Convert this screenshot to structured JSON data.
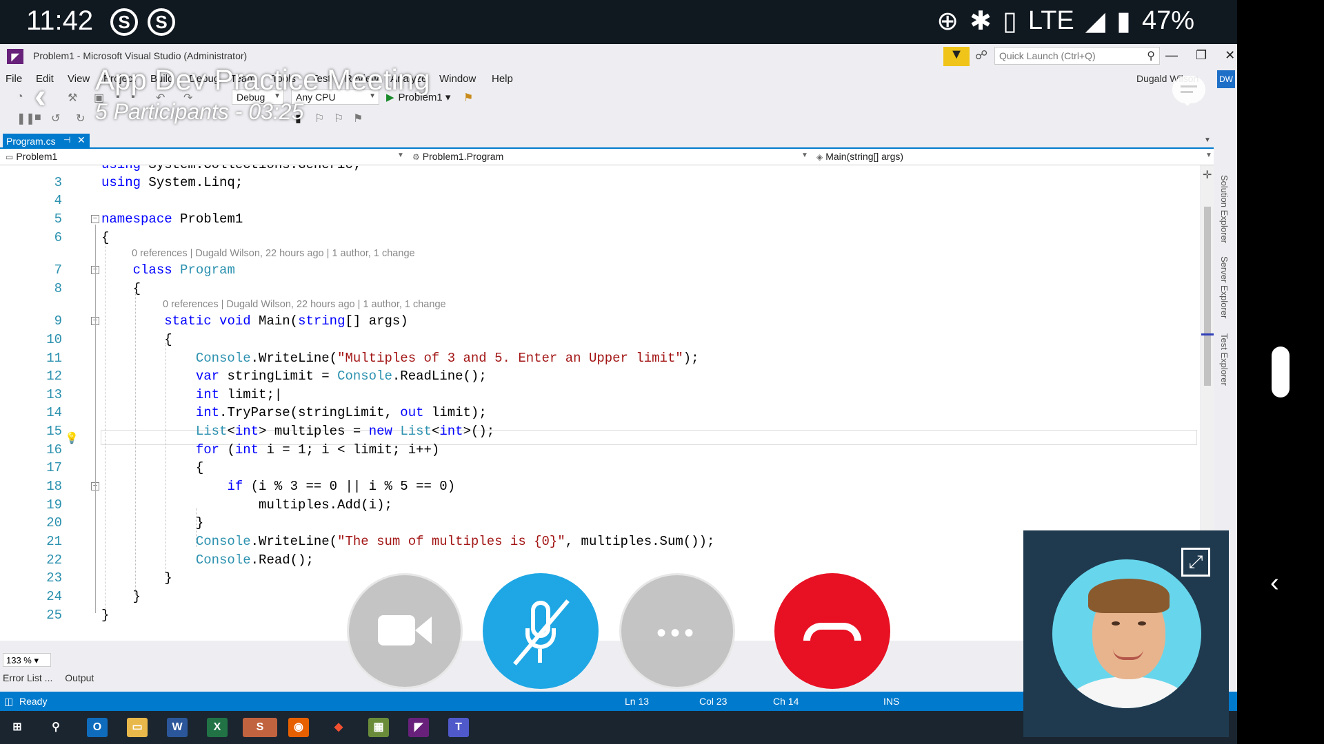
{
  "phone_status": {
    "time": "11:42",
    "notif1": "S",
    "notif2": "S",
    "network": "LTE",
    "battery": "47%"
  },
  "vs": {
    "title": "Problem1 - Microsoft Visual Studio (Administrator)",
    "quick_launch_placeholder": "Quick Launch (Ctrl+Q)",
    "user": "Dugald Wilson",
    "user_initials": "DW",
    "menu": [
      "File",
      "Edit",
      "View",
      "Project",
      "Build",
      "Debug",
      "Team",
      "Tools",
      "Test",
      "Review",
      "Analyze",
      "Window",
      "Help"
    ],
    "toolbar": {
      "config": "Debug",
      "platform": "Any CPU",
      "run": "Problem1"
    },
    "tab": {
      "label": "Program.cs"
    },
    "nav": {
      "project": "Problem1",
      "class": "Problem1.Program",
      "member": "Main(string[] args)"
    },
    "lens": {
      "class": "0 references | Dugald Wilson, 22 hours ago | 1 author, 1 change",
      "main": "0 references | Dugald Wilson, 22 hours ago | 1 author, 1 change"
    },
    "line_numbers": [
      "3",
      "4",
      "5",
      "6",
      "7",
      "8",
      "9",
      "10",
      "11",
      "12",
      "13",
      "14",
      "15",
      "16",
      "17",
      "18",
      "19",
      "20",
      "21",
      "22",
      "23",
      "24",
      "25"
    ],
    "side_panels": [
      "Solution Explorer",
      "Server Explorer",
      "Test Explorer"
    ],
    "zoom": "133 %",
    "bottom_tabs": [
      "Error List ...",
      "Output"
    ],
    "status": {
      "state": "Ready",
      "ln": "Ln 13",
      "col": "Col 23",
      "ch": "Ch 14",
      "mode": "INS"
    }
  },
  "meeting": {
    "title": "App Dev Practice Meeting",
    "subtitle": "5 Participants - 03:25"
  },
  "colors": {
    "vs_blue": "#007acc",
    "mute_blue": "#1ea7e4",
    "hangup_red": "#e81123"
  }
}
